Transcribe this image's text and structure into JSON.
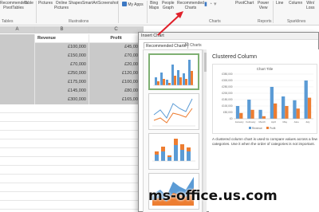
{
  "ribbon": {
    "buttons": [
      {
        "line1": "Recommended",
        "line2": "PivotTables"
      },
      {
        "line1": "Table",
        "line2": ""
      },
      {
        "line1": "Pictures",
        "line2": ""
      },
      {
        "line1": "Online",
        "line2": "Pictures"
      },
      {
        "line1": "Shapes",
        "line2": ""
      },
      {
        "line1": "SmartArt",
        "line2": ""
      },
      {
        "line1": "Screenshot",
        "line2": ""
      },
      {
        "line1": "My Apps",
        "line2": ""
      },
      {
        "line1": "Bing",
        "line2": "Maps"
      },
      {
        "line1": "People",
        "line2": "Graph"
      },
      {
        "line1": "Recommended",
        "line2": "Charts"
      },
      {
        "line1": "PivotChart",
        "line2": ""
      },
      {
        "line1": "Power",
        "line2": "View"
      },
      {
        "line1": "Line",
        "line2": ""
      },
      {
        "line1": "Column",
        "line2": ""
      },
      {
        "line1": "Win/",
        "line2": "Loss"
      }
    ],
    "groups": [
      "Tables",
      "Illustrations",
      "Charts",
      "Reports",
      "Sparklines"
    ]
  },
  "sheet": {
    "columns": [
      "A",
      "B",
      "C"
    ],
    "headers": [
      "",
      "Revenue",
      "Profit"
    ],
    "rows": [
      {
        "revenue": "£100,000",
        "profit": "£45,000"
      },
      {
        "revenue": "£150,000",
        "profit": "£70,000"
      },
      {
        "revenue": "£70,000",
        "profit": "£20,000"
      },
      {
        "revenue": "£250,000",
        "profit": "£120,000"
      },
      {
        "revenue": "£175,000",
        "profit": "£100,000"
      },
      {
        "revenue": "£145,000",
        "profit": "£80,000"
      },
      {
        "revenue": "£300,000",
        "profit": "£165,000"
      }
    ]
  },
  "dialog": {
    "title": "Insert Chart",
    "tabs": [
      "Recommended Charts",
      "All Charts"
    ],
    "chart_name": "Clustered Column",
    "description": "A clustered column chart is used to compare values across a few categories. Use it when the order of categories is not important."
  },
  "chart_data": {
    "type": "bar",
    "title": "Chart Title",
    "categories": [
      "January",
      "February",
      "March",
      "April",
      "May",
      "June",
      "July"
    ],
    "series": [
      {
        "name": "Revenue",
        "values": [
          100000,
          150000,
          70000,
          250000,
          175000,
          145000,
          300000
        ]
      },
      {
        "name": "Profit",
        "values": [
          45000,
          70000,
          20000,
          120000,
          100000,
          80000,
          165000
        ]
      }
    ],
    "ylim": [
      0,
      350000
    ],
    "yticks": [
      "£0",
      "£50,000",
      "£100,000",
      "£150,000",
      "£200,000",
      "£250,000",
      "£300,000",
      "£350,000"
    ],
    "colors": {
      "Revenue": "#5b9bd5",
      "Profit": "#ed7d31"
    },
    "legend": "bottom",
    "grid": true
  },
  "watermark": "ms-office.us.com",
  "colors": {
    "arrow": "#e0202a",
    "selected_thumb": "#7fb073"
  }
}
